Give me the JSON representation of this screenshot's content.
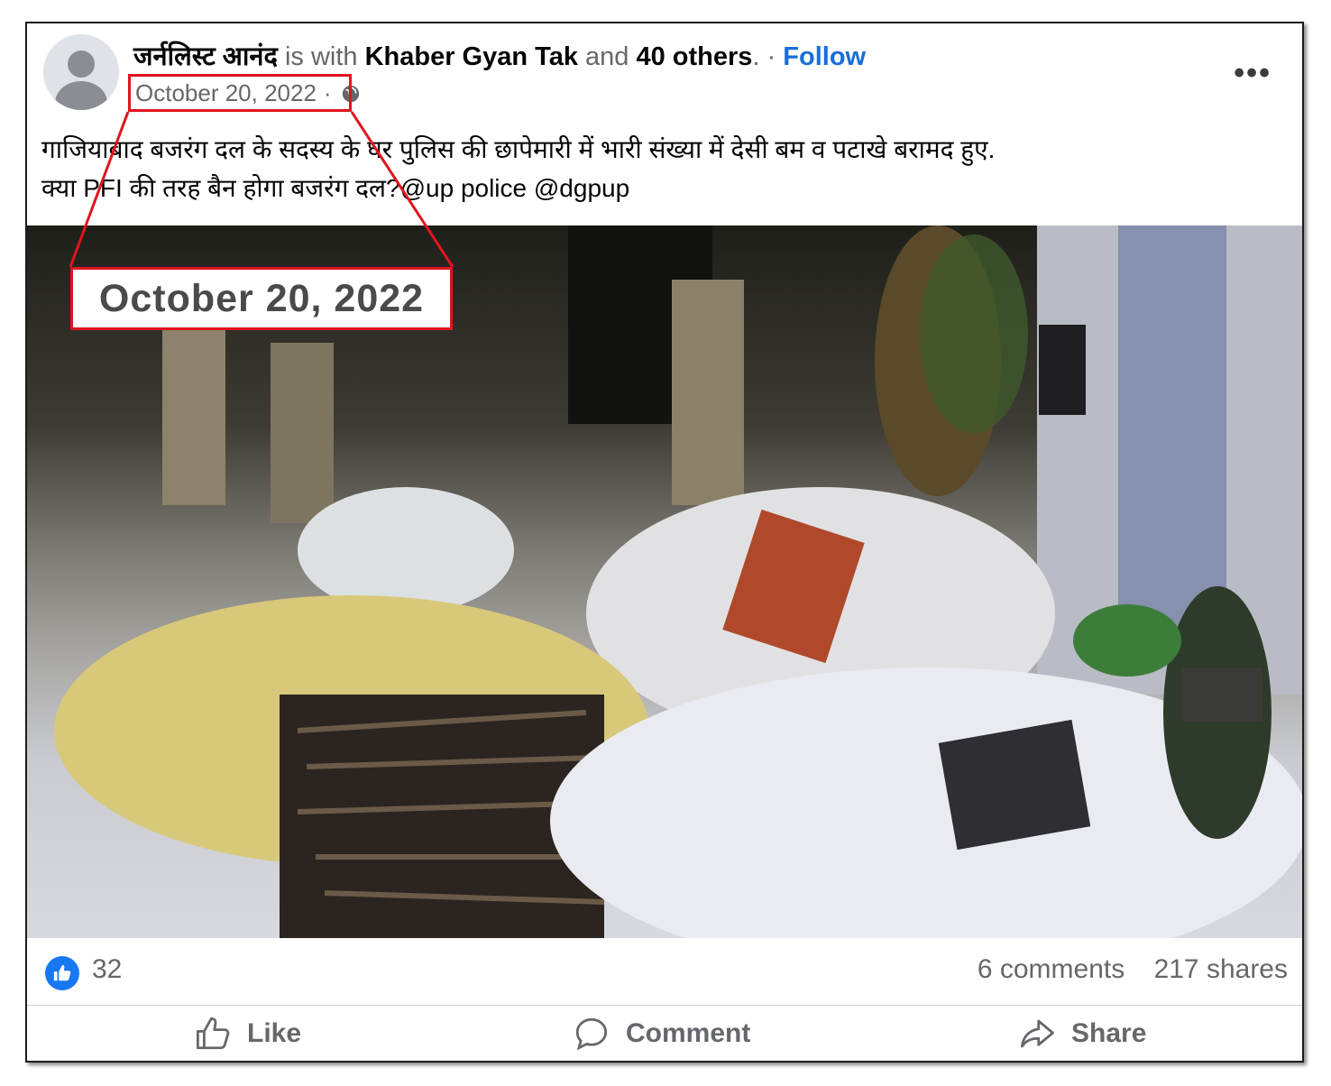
{
  "post": {
    "author": "जर्नलिस्ट आनंद",
    "with_text": "is with",
    "tagged": "Khaber Gyan Tak",
    "and_text": "and",
    "others": "40 others",
    "period": ".",
    "separator": "·",
    "follow_label": "Follow",
    "date": "October 20, 2022",
    "date_separator": "·",
    "more_label": "•••",
    "text_line1": "गाजियाबाद बजरंग दल के सदस्य के घर पुलिस की छापेमारी में भारी संख्या में देसी बम व पटाखे बरामद हुए.",
    "text_line2": "क्या PFI की तरह बैन होगा बजरंग दल?@up police @dgpup"
  },
  "annotation": {
    "zoomed_date": "October 20, 2022",
    "highlight_color": "#e0141e"
  },
  "video": {
    "mute_icon": "speaker-muted-icon"
  },
  "stats": {
    "likes": "32",
    "comments": "6 comments",
    "shares": "217 shares"
  },
  "actions": {
    "like_label": "Like",
    "comment_label": "Comment",
    "share_label": "Share"
  },
  "colors": {
    "accent": "#1877f2",
    "follow": "#1a6ed8",
    "muted_text": "#65676b"
  }
}
